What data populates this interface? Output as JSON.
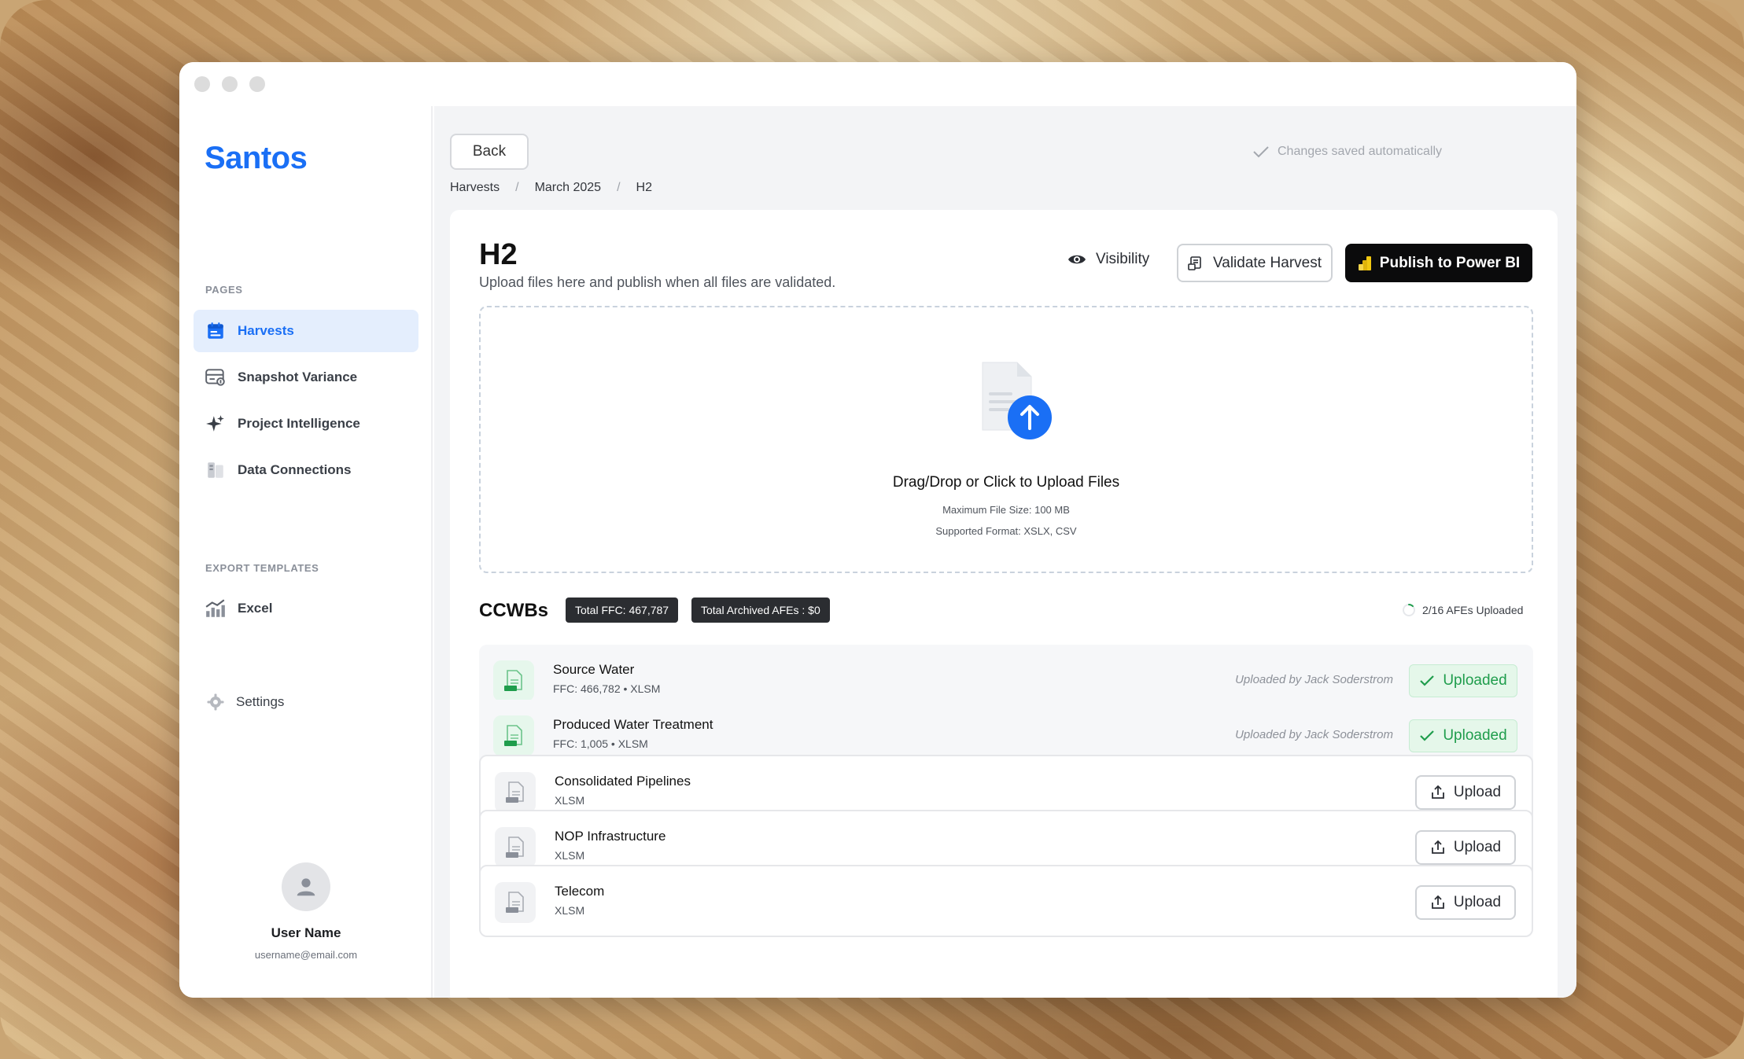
{
  "sidebar": {
    "logo": "Santos",
    "pages_title": "PAGES",
    "pages": [
      {
        "label": "Harvests",
        "icon": "calendar-icon"
      },
      {
        "label": "Snapshot Variance",
        "icon": "snapshot-icon"
      },
      {
        "label": "Project Intelligence",
        "icon": "sparkle-icon"
      },
      {
        "label": "Data Connections",
        "icon": "data-connections-icon"
      }
    ],
    "export_title": "EXPORT TEMPLATES",
    "export_items": [
      {
        "label": "Excel",
        "icon": "chart-growth-icon"
      }
    ],
    "settings_label": "Settings",
    "user": {
      "name": "User Name",
      "email": "username@email.com"
    }
  },
  "header": {
    "back_label": "Back",
    "breadcrumb": [
      "Harvests",
      "March 2025",
      "H2"
    ],
    "autosave_text": "Changes saved automatically"
  },
  "page": {
    "title": "H2",
    "subtitle": "Upload files here and publish when all files are validated.",
    "visibility_label": "Visibility",
    "validate_label": "Validate Harvest",
    "publish_label": "Publish to Power BI"
  },
  "dropzone": {
    "title": "Drag/Drop or Click to Upload Files",
    "max_size": "Maximum File Size: 100 MB",
    "formats": "Supported Format: XSLX, CSV"
  },
  "ccwbs": {
    "title": "CCWBs",
    "total_ffc": "Total FFC: 467,787",
    "total_archived": "Total Archived AFEs : $0",
    "afe_status": "2/16 AFEs Uploaded",
    "afe_progress": 0.125,
    "rows": [
      {
        "name": "Source Water",
        "meta": "FFC: 466,782  •  XLSM",
        "uploaded_by": "Uploaded by Jack Soderstrom",
        "status": "Uploaded"
      },
      {
        "name": "Produced Water Treatment",
        "meta": "FFC: 1,005  •  XLSM",
        "uploaded_by": "Uploaded by Jack Soderstrom",
        "status": "Uploaded"
      },
      {
        "name": "Consolidated Pipelines",
        "meta": "XLSM",
        "action": "Upload"
      },
      {
        "name": "NOP Infrastructure",
        "meta": "XLSM",
        "action": "Upload"
      },
      {
        "name": "Telecom",
        "meta": "XLSM",
        "action": "Upload"
      }
    ]
  },
  "colors": {
    "accent": "#1a6ff5",
    "success": "#1f9d4c",
    "dark": "#0b0b0c"
  }
}
